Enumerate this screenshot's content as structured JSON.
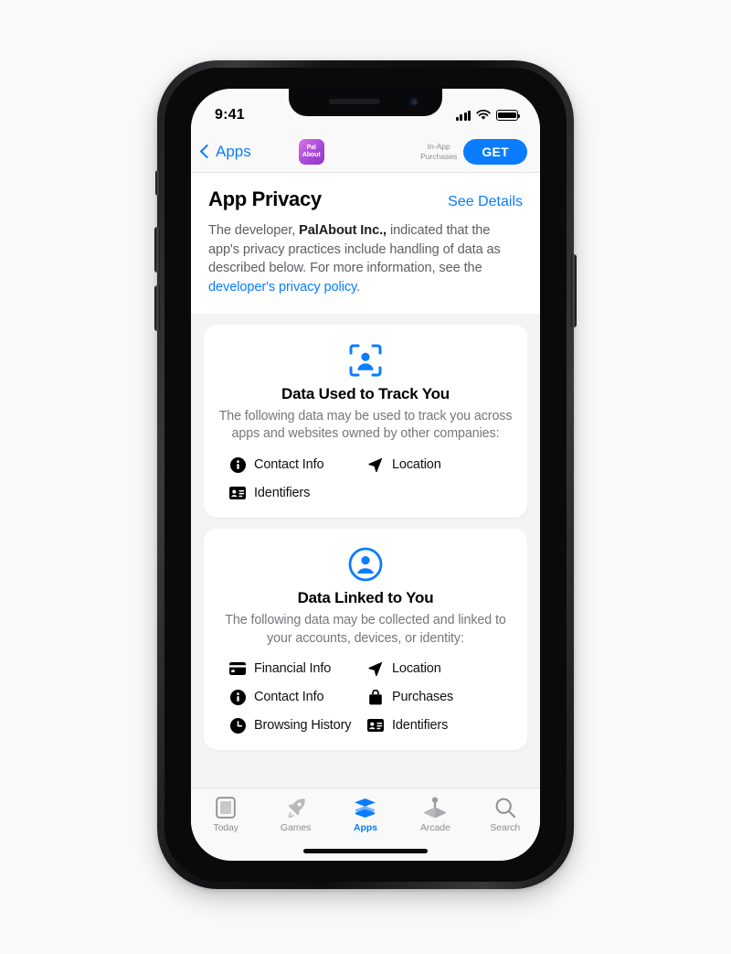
{
  "status_bar": {
    "time": "9:41",
    "signal_icon": "cellular-bars-icon",
    "wifi_icon": "wifi-icon",
    "battery_icon": "battery-full-icon"
  },
  "nav_bar": {
    "back_label": "Apps",
    "back_icon": "chevron-left-icon",
    "app_icon_line1": "Pal",
    "app_icon_line2": "About",
    "in_app_purchases_line1": "In-App",
    "in_app_purchases_line2": "Purchases",
    "get_label": "GET"
  },
  "privacy_header": {
    "title": "App Privacy",
    "see_details_label": "See Details",
    "description_part1": "The developer, ",
    "developer_name": "PalAbout Inc.,",
    "description_part2": " indicated that the app's privacy practices include handling of data as described below. For more information, see the ",
    "policy_link_label": "developer's privacy policy",
    "description_part3": "."
  },
  "cards": [
    {
      "icon": "track-you-icon",
      "title": "Data Used to Track You",
      "subtitle": "The following data may be used to track you across apps and websites owned by other companies:",
      "items": [
        {
          "icon": "info-circle-icon",
          "label": "Contact Info"
        },
        {
          "icon": "location-arrow-icon",
          "label": "Location"
        },
        {
          "icon": "identity-card-icon",
          "label": "Identifiers"
        }
      ]
    },
    {
      "icon": "person-circle-icon",
      "title": "Data Linked to You",
      "subtitle": "The following data may be collected and linked to your accounts, devices, or identity:",
      "items": [
        {
          "icon": "credit-card-icon",
          "label": "Financial Info"
        },
        {
          "icon": "location-arrow-icon",
          "label": "Location"
        },
        {
          "icon": "info-circle-icon",
          "label": "Contact Info"
        },
        {
          "icon": "shopping-bag-icon",
          "label": "Purchases"
        },
        {
          "icon": "clock-icon",
          "label": "Browsing History"
        },
        {
          "icon": "identity-card-icon",
          "label": "Identifiers"
        }
      ]
    }
  ],
  "tab_bar": {
    "tabs": [
      {
        "icon": "today-icon",
        "label": "Today",
        "active": false
      },
      {
        "icon": "rocket-icon",
        "label": "Games",
        "active": false
      },
      {
        "icon": "layers-icon",
        "label": "Apps",
        "active": true
      },
      {
        "icon": "joystick-icon",
        "label": "Arcade",
        "active": false
      },
      {
        "icon": "search-icon",
        "label": "Search",
        "active": false
      }
    ]
  },
  "colors": {
    "accent_blue": "#0a7cff",
    "app_icon_purple": "#b14fd8",
    "inactive_gray": "#8e8e93",
    "page_background": "#f9f9f9"
  }
}
